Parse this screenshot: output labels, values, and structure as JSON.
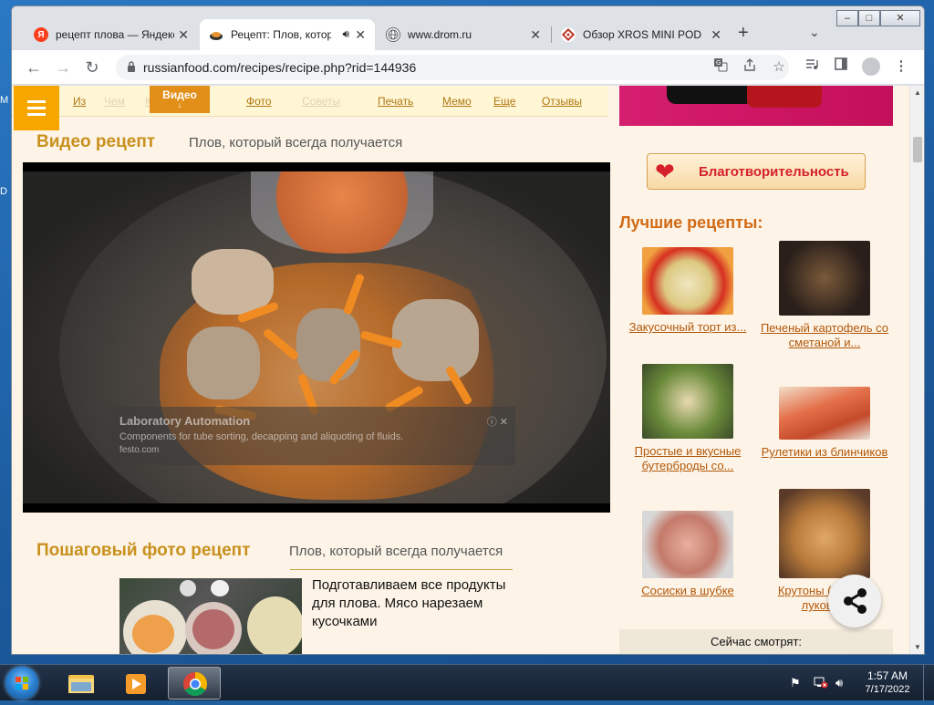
{
  "desktop": {
    "edge_letters": [
      "M",
      "D"
    ]
  },
  "browser": {
    "tabs": [
      {
        "title": "рецепт плова — Яндекс",
        "icon": "yandex-icon",
        "icon_char": "Я",
        "active": false
      },
      {
        "title": "Рецепт: Плов, который",
        "icon": "plov-favicon",
        "icon_char": "",
        "active": true,
        "audio": "speaker-icon"
      },
      {
        "title": "www.drom.ru",
        "icon": "globe-icon",
        "icon_char": "",
        "active": false
      },
      {
        "title": "Обзор XROS MINI POD",
        "icon": "pattern-favicon",
        "icon_char": "",
        "active": false
      }
    ],
    "new_tab_symbol": "+",
    "tab_search_symbol": "⌄",
    "window_controls": {
      "minimize": "–",
      "maximize": "□",
      "close": "✕"
    },
    "nav": {
      "back": "←",
      "forward": "→",
      "reload": "↻"
    },
    "url": "russianfood.com/recipes/recipe.php?rid=144936",
    "toolbar_icons": [
      "translate-icon",
      "share-page-icon",
      "bookmark-star-icon",
      "media-control-icon",
      "side-panel-icon",
      "profile-icon",
      "menu-dots-icon"
    ]
  },
  "page": {
    "menu": {
      "items": [
        {
          "label": "Из",
          "faded": false
        },
        {
          "label": "Чем",
          "faded": true
        },
        {
          "label": "Как",
          "faded": true
        },
        {
          "label": "Фото",
          "faded": false
        },
        {
          "label": "Советы",
          "faded": true
        },
        {
          "label": "Печать",
          "faded": false
        },
        {
          "label": "Мемо",
          "faded": false
        },
        {
          "label": "Еще",
          "faded": false
        },
        {
          "label": "Отзывы",
          "faded": false
        }
      ],
      "video_label": "Видео",
      "video_arrow": "↓"
    },
    "video_section": {
      "title": "Видео рецепт",
      "subtitle": "Плов, который всегда получается"
    },
    "video_ad": {
      "title": "Laboratory Automation",
      "text": "Components for tube sorting, decapping and aliquoting of fluids.",
      "site": "festo.com",
      "close": "ⓘ ✕"
    },
    "photo_section": {
      "title": "Пошаговый фото рецепт",
      "subtitle": "Плов, который всегда получается"
    },
    "step_text": "Подготавливаем все продукты для плова. Мясо нарезаем кусочками",
    "sidebar": {
      "charity_label": "Благотворительность",
      "best_title": "Лучшие рецепты:",
      "cards": [
        {
          "caption": "Закусочный торт из..."
        },
        {
          "caption": "Печеный картофель со сметаной и..."
        },
        {
          "caption": "Простые и вкусные бутерброды со..."
        },
        {
          "caption": "Рулетики из блинчиков"
        },
        {
          "caption": "Сосиски в шубке"
        },
        {
          "caption": "Крутоны (гренки) луковые"
        }
      ],
      "now_watching": "Сейчас смотрят:"
    }
  },
  "taskbar": {
    "apps": [
      "explorer-icon",
      "media-player-icon",
      "chrome-icon"
    ],
    "tray_icons": [
      "action-center-icon",
      "network-icon",
      "volume-icon"
    ],
    "time": "1:57 AM",
    "date": "7/17/2022"
  },
  "colors": {
    "accent_orange": "#e18f18",
    "section_title": "#c8901d",
    "link_brown": "#b2580b",
    "best_title": "#d16a14"
  }
}
